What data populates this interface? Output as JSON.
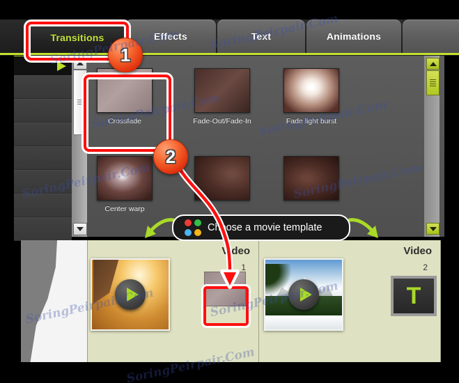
{
  "tabs": [
    {
      "label": "Transitions",
      "active": true
    },
    {
      "label": "Effects",
      "active": false
    },
    {
      "label": "Text",
      "active": false
    },
    {
      "label": "Animations",
      "active": false
    },
    {
      "label": "",
      "active": false
    }
  ],
  "transitions": [
    {
      "name": "Crossfade",
      "thumb": "th-crossfade",
      "selected": true
    },
    {
      "name": "Fade-Out/Fade-In",
      "thumb": "th-fadeout",
      "selected": false
    },
    {
      "name": "Fade light burst",
      "thumb": "th-burst",
      "selected": false
    },
    {
      "name": "Center warp",
      "thumb": "th-center",
      "selected": false
    },
    {
      "name": "",
      "thumb": "th-d5",
      "selected": false
    },
    {
      "name": "",
      "thumb": "th-d6",
      "selected": false
    }
  ],
  "tooltip": {
    "text": "Choose a movie template",
    "dots": [
      "#ee3b33",
      "#34bf49",
      "#4eb3f0",
      "#f5b719"
    ]
  },
  "timeline": {
    "tracks": [
      {
        "title": "Video",
        "number": "1"
      },
      {
        "title": "Video",
        "number": "2"
      }
    ],
    "text_slot_glyph": "T"
  },
  "annotations": {
    "badge_one": "1",
    "badge_two": "2",
    "accent_red": "#ff0f0f",
    "accent_lime": "#c4e22e",
    "badge_orange": "#e02f0c"
  },
  "watermarks": [
    "SoringPeirpair.Com",
    "SoringPeirpair.Com",
    "SoringPeirpair.Com",
    "SoringPeirpair.Com",
    "SoringPeirpair.Com",
    "SoringPeirpair.Com",
    "SoringPeirpair.Com",
    "SoringPeirpair.Com",
    "SoringPeirpair.Com"
  ]
}
